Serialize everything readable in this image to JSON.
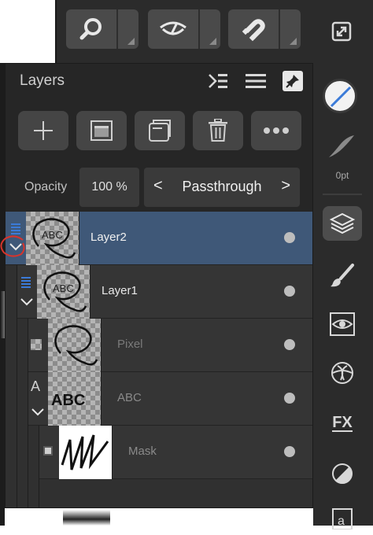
{
  "panel": {
    "title": "Layers",
    "opacity_label": "Opacity",
    "opacity_value": "100 %",
    "blend_mode": "Passthrough",
    "blend_prev": "<",
    "blend_next": ">"
  },
  "layers": [
    {
      "name": "Layer2",
      "selected": true,
      "thumb_text": "ABC"
    },
    {
      "name": "Layer1",
      "selected": false,
      "thumb_text": "ABC"
    },
    {
      "name": "Pixel",
      "selected": false
    },
    {
      "name": "ABC",
      "selected": false,
      "thumb_text": "ABC"
    },
    {
      "name": "Mask",
      "selected": false
    }
  ],
  "sidebar": {
    "stroke_width_label": "0pt",
    "fx_label": "FX"
  },
  "colors": {
    "selection": "#3f5878",
    "panel": "#262626",
    "accent_blue": "#3b7bd8",
    "annotation_red": "#d9342b"
  }
}
